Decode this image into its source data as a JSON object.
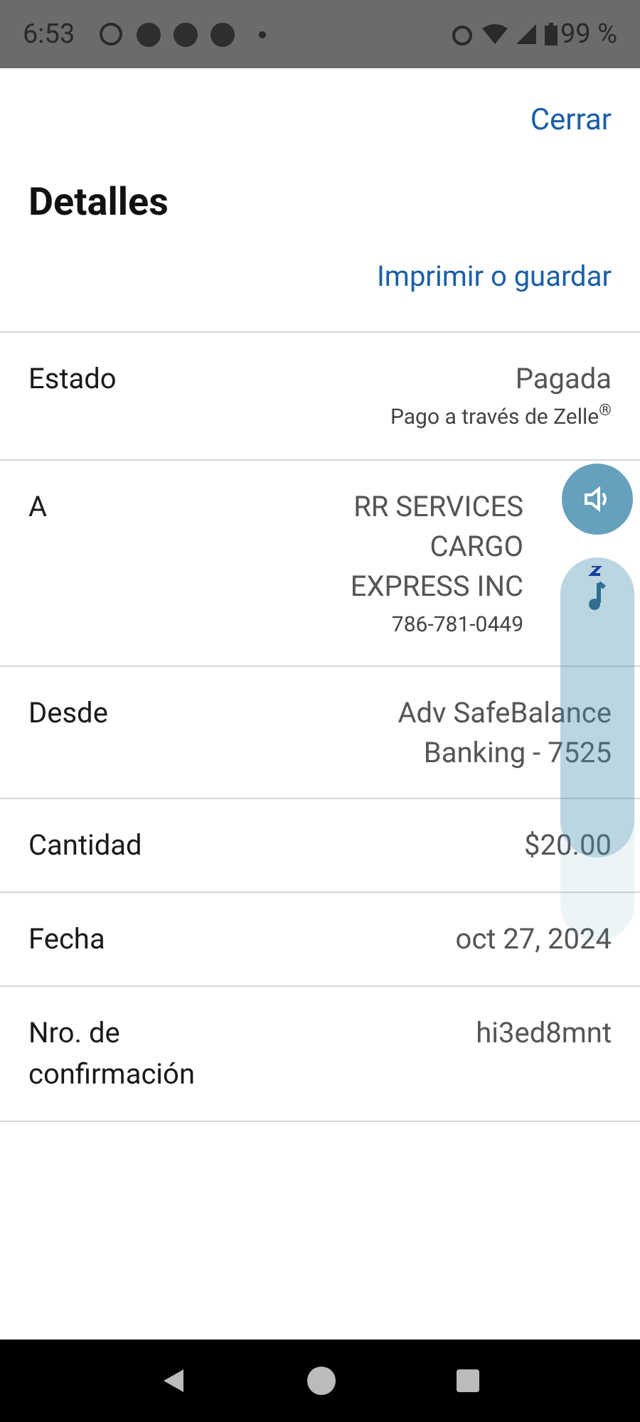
{
  "status_bar": {
    "time": "6:53",
    "battery": "99 %"
  },
  "header": {
    "close": "Cerrar",
    "title": "Detalles",
    "print": "Imprimir o guardar"
  },
  "rows": [
    {
      "label": "Estado",
      "value": "Pagada",
      "note": "Pago a través de Zelle$^{®}$"
    },
    {
      "label": "A",
      "value": "RR SERVICES CARGO EXPRESS INC",
      "note": "786-781-0449"
    },
    {
      "label": "Desde",
      "value": "Adv SafeBalance Banking - 7525"
    },
    {
      "label": "Cantidad",
      "value": "$20.00"
    },
    {
      "label": "Fecha",
      "value": "oct 27, 2024"
    },
    {
      "label": "Nro. de confirmación",
      "value": "hi3ed8mnt"
    }
  ],
  "volume": {
    "level": 0.78
  }
}
